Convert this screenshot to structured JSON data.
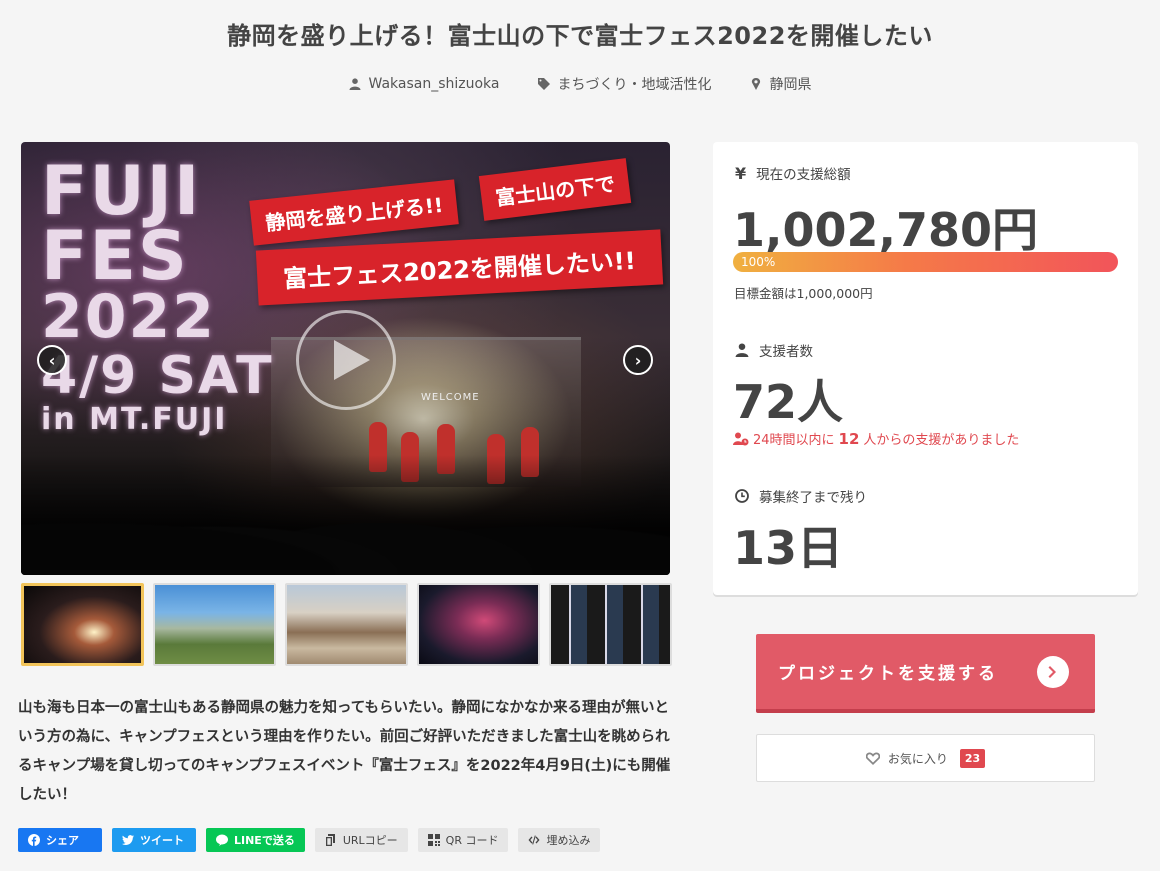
{
  "project": {
    "title": "静岡を盛り上げる！富士山の下で富士フェス2022を開催したい",
    "author": "Wakasan_shizuoka",
    "category": "まちづくり・地域活性化",
    "location": "静岡県"
  },
  "hero": {
    "fuji_lines": [
      "FUJI",
      "FES",
      "2022",
      "4/9 SAT",
      "in MT.FUJI"
    ],
    "banner_1": "静岡を盛り上げる!!",
    "banner_2": "富士山の下で",
    "banner_3": "富士フェス2022を開催したい!!",
    "stage_sign": "WELCOME",
    "prev_label": "‹",
    "next_label": "›"
  },
  "thumbnails": [
    {
      "name": "thumb-1",
      "active": true
    },
    {
      "name": "thumb-2",
      "active": false
    },
    {
      "name": "thumb-3",
      "active": false
    },
    {
      "name": "thumb-4",
      "active": false
    },
    {
      "name": "thumb-5",
      "active": false
    }
  ],
  "description": "山も海も日本一の富士山もある静岡県の魅力を知ってもらいたい。静岡になかなか来る理由が無いという方の為に、キャンプフェスという理由を作りたい。前回ご好評いただきました富士山を眺められるキャンプ場を貸し切ってのキャンプフェスイベント『富士フェス』を2022年4月9日(土)にも開催したい！",
  "share": {
    "facebook": "シェア",
    "twitter": "ツイート",
    "line": "LINEで送る",
    "url_copy": "URLコピー",
    "qr": "QR コード",
    "embed": "埋め込み"
  },
  "stats": {
    "amount_label": "現在の支援総額",
    "amount_value": "1,002,780円",
    "progress_text": "100%",
    "progress": 1.0,
    "goal_text": "目標金額は1,000,000円",
    "backers_label": "支援者数",
    "backers_value": "72人",
    "recent_pre": "24時間以内に",
    "recent_count": "12",
    "recent_post": "人からの支援がありました",
    "remaining_label": "募集終了まで残り",
    "remaining_value": "13日",
    "yen_icon": "¥"
  },
  "actions": {
    "support_label": "プロジェクトを支援する",
    "favorite_label": "お気に入り",
    "favorite_count": "23"
  },
  "colors": {
    "accent_red": "#e15a67",
    "alert_red": "#e0484f",
    "progress_start": "#f0b040",
    "progress_end": "#f2545a",
    "facebook": "#1877f2",
    "twitter": "#1d9bf0",
    "line": "#06c755"
  }
}
